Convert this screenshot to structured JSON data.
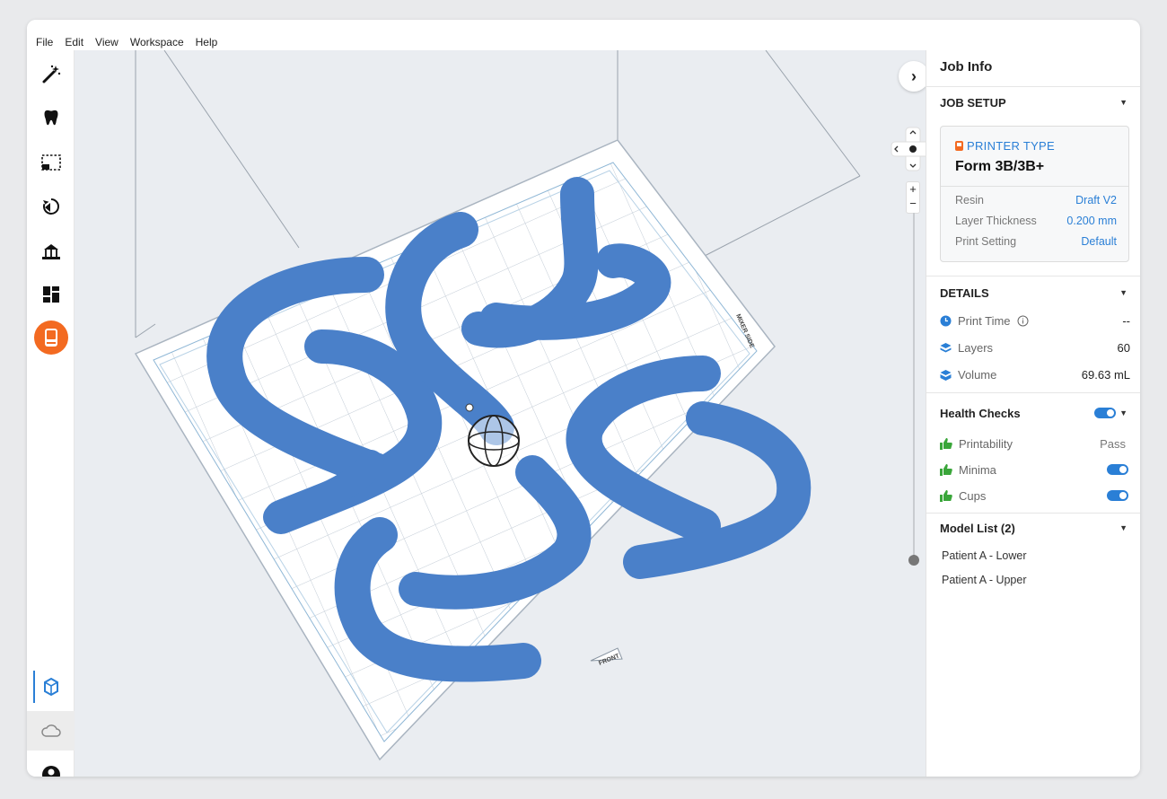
{
  "menu": [
    "File",
    "Edit",
    "View",
    "Workspace",
    "Help"
  ],
  "toolbar": {
    "tools": [
      "magic-wand-icon",
      "tooth-icon",
      "selection-box-icon",
      "orientation-icon",
      "supports-icon",
      "layout-icon",
      "printer-icon"
    ],
    "bottom": [
      "workspace-3d-icon",
      "cloud-icon",
      "account-icon"
    ],
    "accent": "#f36a21"
  },
  "viewport": {
    "model_color": "#4a80c9",
    "front_label": "FRONT",
    "side_label": "MIXER SIDE",
    "zoom_in": "+",
    "zoom_out": "−",
    "expand_label": "›"
  },
  "panel": {
    "title": "Job Info",
    "job_setup": {
      "heading": "JOB SETUP",
      "printer_type_label": "PRINTER TYPE",
      "printer_name": "Form 3B/3B+",
      "resin_label": "Resin",
      "resin_value": "Draft V2",
      "layer_label": "Layer Thickness",
      "layer_value": "0.200 mm",
      "setting_label": "Print Setting",
      "setting_value": "Default"
    },
    "details": {
      "heading": "DETAILS",
      "print_time_label": "Print Time",
      "print_time_value": "--",
      "layers_label": "Layers",
      "layers_value": "60",
      "volume_label": "Volume",
      "volume_value": "69.63 mL"
    },
    "health": {
      "heading": "Health Checks",
      "printability_label": "Printability",
      "printability_value": "Pass",
      "minima_label": "Minima",
      "cups_label": "Cups"
    },
    "models": {
      "heading": "Model List (2)",
      "items": [
        "Patient A - Lower",
        "Patient A - Upper"
      ]
    }
  }
}
